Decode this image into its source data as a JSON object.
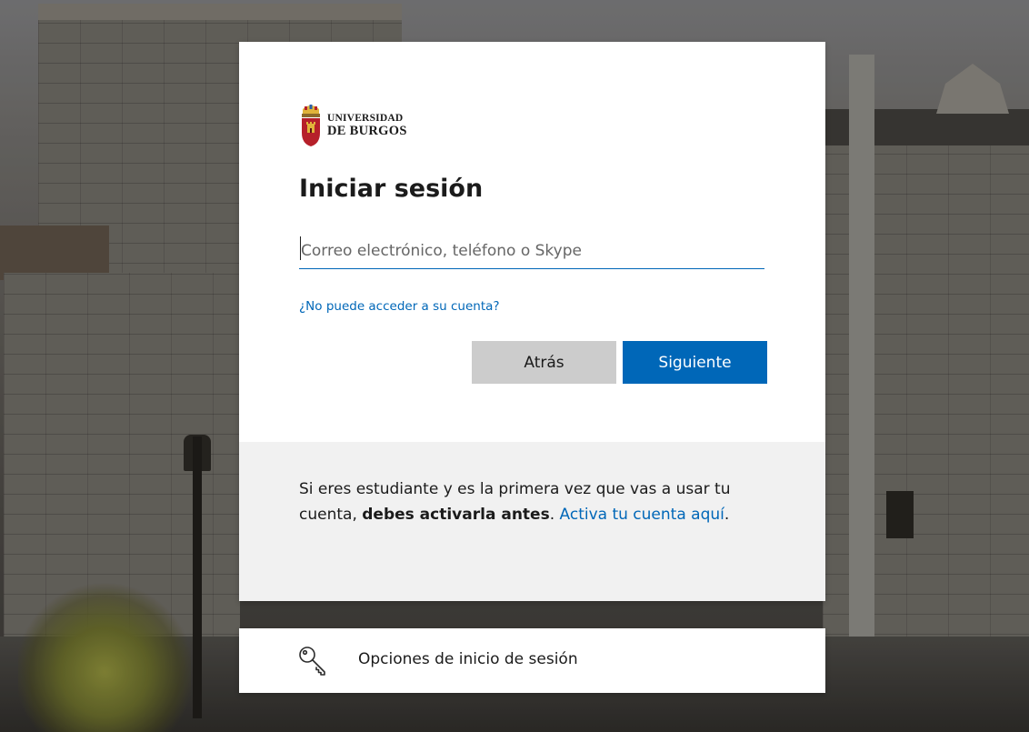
{
  "brand": {
    "line1": "UNIVERSIDAD",
    "line2": "DE BURGOS",
    "crest_colors": {
      "shield_red": "#b6202a",
      "gold": "#e0b43a",
      "blue": "#2a5fa8"
    }
  },
  "signin": {
    "title": "Iniciar sesión",
    "email_placeholder": "Correo electrónico, teléfono o Skype",
    "email_value": "",
    "help_link": "¿No puede acceder a su cuenta?",
    "back_label": "Atrás",
    "next_label": "Siguiente"
  },
  "notice": {
    "text_before": "Si eres estudiante y es la primera vez que vas a usar tu cuenta, ",
    "bold": "debes activarla antes",
    "text_middle": ". ",
    "link": "Activa tu cuenta aquí",
    "text_after": "."
  },
  "options": {
    "label": "Opciones de inicio de sesión",
    "icon": "key-icon"
  },
  "colors": {
    "accent": "#0067b8",
    "back_button": "#cccccc",
    "footer_bg": "#f1f1f1"
  }
}
